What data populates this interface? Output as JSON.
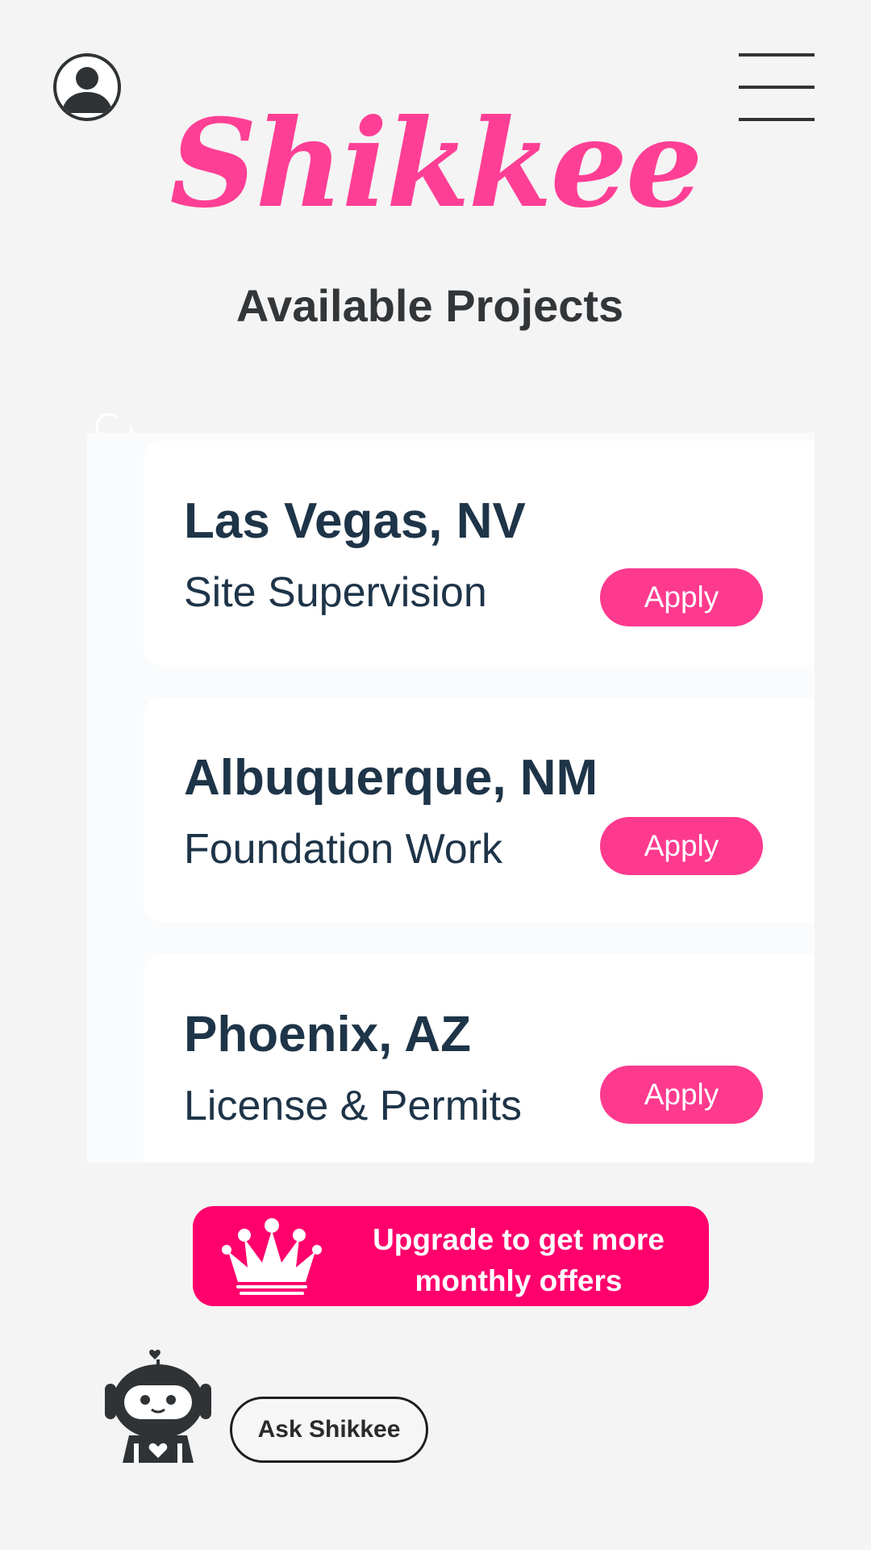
{
  "header": {
    "profile_icon": "user-circle-icon",
    "menu_icon": "hamburger-menu-icon",
    "logo_text": "Shikkee",
    "title": "Available Projects"
  },
  "colors": {
    "brand_pink": "#fe3f95",
    "apply_pink": "#fe3a8e",
    "upgrade_pink": "#ff006d",
    "text_navy": "#1e3448",
    "background": "#f4f4f4"
  },
  "projects": [
    {
      "city": "Las Vegas, NV",
      "service": "Site Supervision",
      "action_label": "Apply"
    },
    {
      "city": "Albuquerque, NM",
      "service": "Foundation Work",
      "action_label": "Apply"
    },
    {
      "city": "Phoenix, AZ",
      "service": "License & Permits",
      "action_label": "Apply"
    }
  ],
  "upgrade": {
    "icon": "crown-icon",
    "line1": "Upgrade to get more",
    "line2": "monthly offers"
  },
  "assistant": {
    "icon": "robot-icon",
    "button_label": "Ask Shikkee"
  }
}
